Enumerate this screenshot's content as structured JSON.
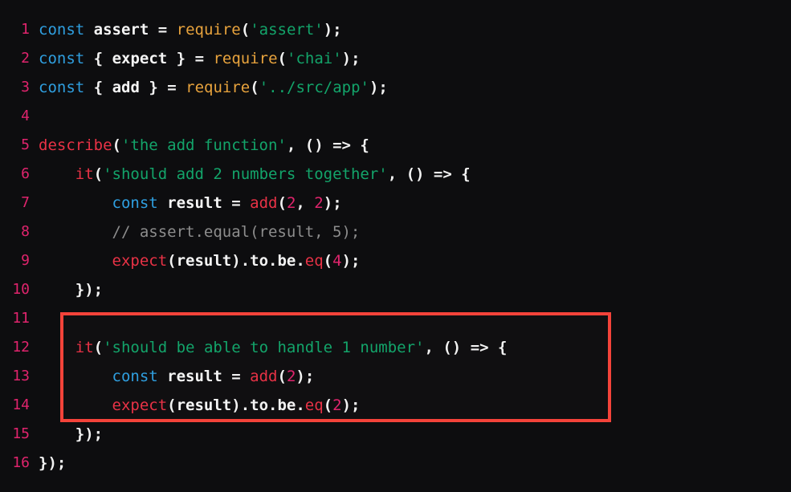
{
  "editor": {
    "name": "code-editor",
    "language": "javascript",
    "total_lines": 16,
    "background_color": "#0d0d0f",
    "gutter_color": "#e0246d",
    "highlight": {
      "name": "red-highlight-box",
      "border_color": "#f4433a",
      "covers_lines": "11-14"
    },
    "syntax_colors": {
      "keyword": "#2f9fe0",
      "identifier": "#f5f5f5",
      "function_orange": "#e8a33d",
      "string": "#13a46a",
      "function_red": "#e83246",
      "number": "#e0246d",
      "comment": "#8d8d8d",
      "punctuation": "#f2f2f2"
    }
  },
  "lines": [
    {
      "n": "1",
      "text": "const assert = require('assert');"
    },
    {
      "n": "2",
      "text": "const { expect } = require('chai');"
    },
    {
      "n": "3",
      "text": "const { add } = require('../src/app');"
    },
    {
      "n": "4",
      "text": ""
    },
    {
      "n": "5",
      "text": "describe('the add function', () => {"
    },
    {
      "n": "6",
      "text": "    it('should add 2 numbers together', () => {"
    },
    {
      "n": "7",
      "text": "        const result = add(2, 2);"
    },
    {
      "n": "8",
      "text": "        // assert.equal(result, 5);"
    },
    {
      "n": "9",
      "text": "        expect(result).to.be.eq(4);"
    },
    {
      "n": "10",
      "text": "    });"
    },
    {
      "n": "11",
      "text": ""
    },
    {
      "n": "12",
      "text": "    it('should be able to handle 1 number', () => {"
    },
    {
      "n": "13",
      "text": "        const result = add(2);"
    },
    {
      "n": "14",
      "text": "        expect(result).to.be.eq(2);"
    },
    {
      "n": "15",
      "text": "    });"
    },
    {
      "n": "16",
      "text": "});"
    }
  ],
  "tokens": {
    "line1": {
      "kw": "const",
      "ident": "assert",
      "op": "=",
      "fn": "require",
      "str": "'assert'"
    },
    "line2": {
      "kw": "const",
      "ident": "expect",
      "op": "=",
      "fn": "require",
      "str": "'chai'"
    },
    "line3": {
      "kw": "const",
      "ident": "add",
      "op": "=",
      "fn": "require",
      "str": "'../src/app'"
    },
    "line5": {
      "fn": "describe",
      "str": "'the add function'",
      "arrow": "=>"
    },
    "line6": {
      "fn": "it",
      "str": "'should add 2 numbers together'",
      "arrow": "=>"
    },
    "line7": {
      "kw": "const",
      "ident": "result",
      "fn": "add",
      "args": [
        "2",
        "2"
      ]
    },
    "line8": {
      "comment": "// assert.equal(result, 5);"
    },
    "line9": {
      "fn": "expect",
      "ident": "result",
      "chain": ".to.be.",
      "eq": "eq",
      "arg": "4"
    },
    "line12": {
      "fn": "it",
      "str": "'should be able to handle 1 number'",
      "arrow": "=>"
    },
    "line13": {
      "kw": "const",
      "ident": "result",
      "fn": "add",
      "args": [
        "2"
      ]
    },
    "line14": {
      "fn": "expect",
      "ident": "result",
      "chain": ".to.be.",
      "eq": "eq",
      "arg": "2"
    }
  }
}
